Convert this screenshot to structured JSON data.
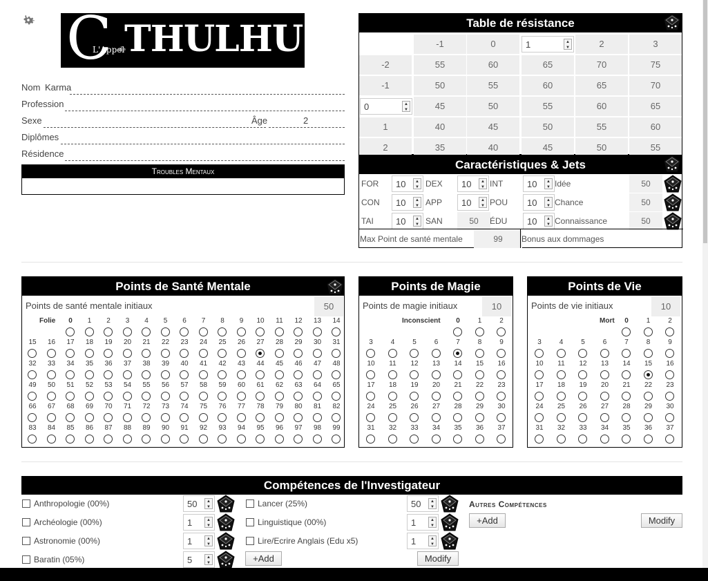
{
  "logo": {
    "main": "THULHU",
    "c": "C",
    "prefix": "L'Appel",
    "de": "de"
  },
  "identity": {
    "name_label": "Nom",
    "name_value": "Karma",
    "profession_label": "Profession",
    "profession_value": "",
    "sex_label": "Sexe",
    "sex_value": "",
    "age_label": "Âge",
    "age_value": "2",
    "diplomas_label": "Diplômes",
    "diplomas_value": "",
    "residence_label": "Résidence",
    "residence_value": ""
  },
  "troubles": {
    "title": "Troubles Mentaux",
    "content": ""
  },
  "resistance": {
    "title": "Table de résistance",
    "col_headers": [
      "-1",
      "0",
      "1",
      "2",
      "3"
    ],
    "row_headers": [
      "-2",
      "-1",
      "0",
      "1",
      "2"
    ],
    "rows": [
      [
        "55",
        "60",
        "65",
        "70",
        "75"
      ],
      [
        "50",
        "55",
        "60",
        "65",
        "70"
      ],
      [
        "45",
        "50",
        "55",
        "60",
        "65"
      ],
      [
        "40",
        "45",
        "50",
        "55",
        "60"
      ],
      [
        "35",
        "40",
        "45",
        "50",
        "55"
      ]
    ]
  },
  "carac": {
    "title": "Caractéristiques & Jets",
    "r1": {
      "l1": "FOR",
      "v1": "10",
      "l2": "DEX",
      "v2": "10",
      "l3": "INT",
      "v3": "10",
      "l4": "Idée",
      "v4": "50"
    },
    "r2": {
      "l1": "CON",
      "v1": "10",
      "l2": "APP",
      "v2": "10",
      "l3": "POU",
      "v3": "10",
      "l4": "Chance",
      "v4": "50"
    },
    "r3": {
      "l1": "TAI",
      "v1": "10",
      "l2": "SAN",
      "v2": "50",
      "l3": "ÉDU",
      "v3": "10",
      "l4": "Connaissance",
      "v4": "50"
    },
    "max_san_label": "Max Point de santé mentale",
    "max_san_value": "99",
    "bonus_label": "Bonus aux dommages",
    "bonus_value": ""
  },
  "sanity": {
    "title": "Points de Santé Mentale",
    "init_label": "Points de santé mentale initiaux",
    "init_value": "50",
    "zero_label": "Folie",
    "selected": 27
  },
  "magic": {
    "title": "Points de Magie",
    "init_label": "Points de magie initiaux",
    "init_value": "10",
    "zero_label": "Inconscient",
    "selected": 7
  },
  "life": {
    "title": "Points de Vie",
    "init_label": "Points de vie initiaux",
    "init_value": "10",
    "zero_label": "Mort",
    "selected": 15
  },
  "skills": {
    "title": "Compétences de l'Investigateur",
    "left": [
      {
        "label": "Anthropologie (00%)",
        "value": "50"
      },
      {
        "label": "Archéologie (00%)",
        "value": "1"
      },
      {
        "label": "Astronomie (00%)",
        "value": "1"
      },
      {
        "label": "Baratin (05%)",
        "value": "5"
      }
    ],
    "right": [
      {
        "label": "Lancer (25%)",
        "value": "50"
      },
      {
        "label": "Linguistique (00%)",
        "value": "1"
      },
      {
        "label": "Lire/Ecrire Anglais (Edu x5)",
        "value": "1"
      }
    ],
    "add_label": "+Add",
    "modify_label": "Modify",
    "other_title": "Autres Compétences",
    "other_add_label": "+Add",
    "other_modify_label": "Modify"
  },
  "icons": {
    "gear": "gear-icon",
    "dice": "dice-icon"
  }
}
